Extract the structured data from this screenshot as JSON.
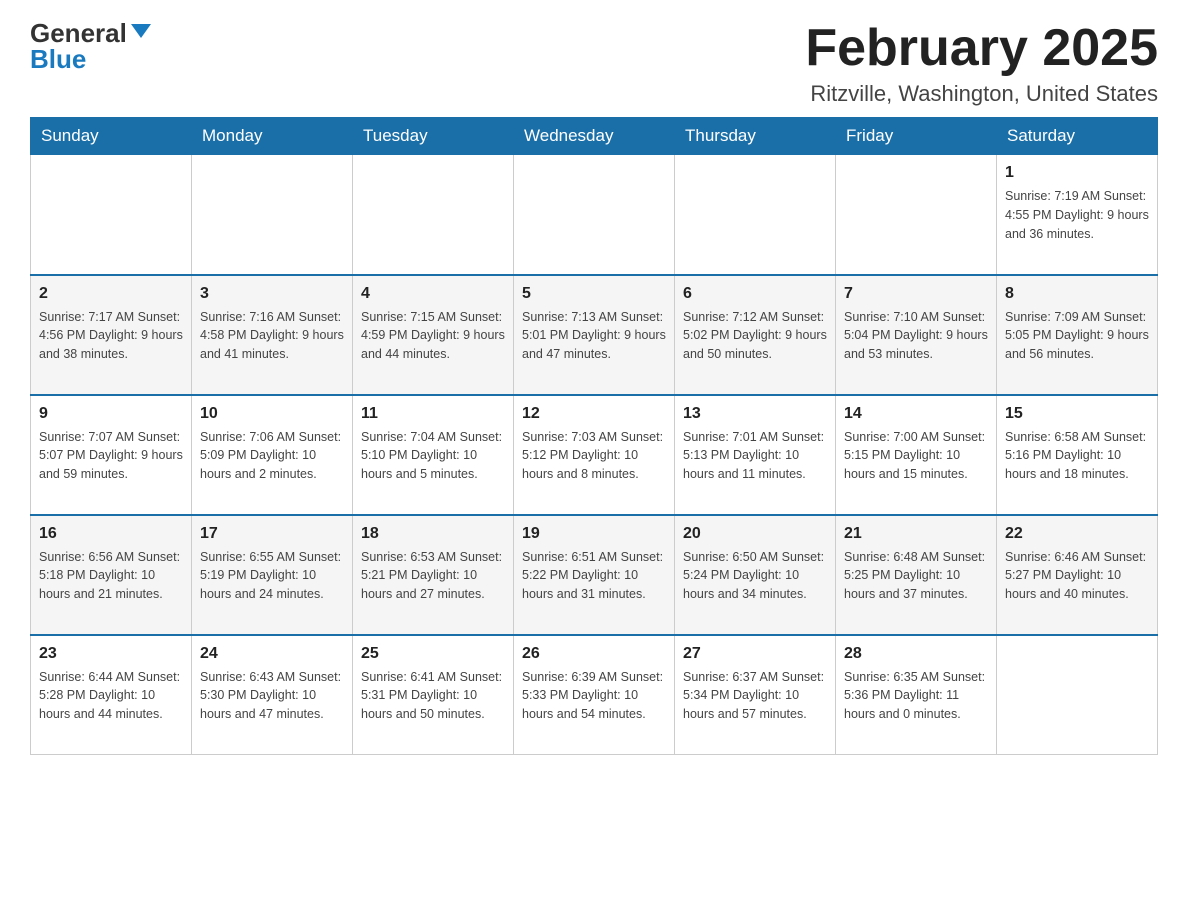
{
  "header": {
    "logo_general": "General",
    "logo_blue": "Blue",
    "title": "February 2025",
    "subtitle": "Ritzville, Washington, United States"
  },
  "days_of_week": [
    "Sunday",
    "Monday",
    "Tuesday",
    "Wednesday",
    "Thursday",
    "Friday",
    "Saturday"
  ],
  "weeks": [
    {
      "days": [
        {
          "num": "",
          "info": ""
        },
        {
          "num": "",
          "info": ""
        },
        {
          "num": "",
          "info": ""
        },
        {
          "num": "",
          "info": ""
        },
        {
          "num": "",
          "info": ""
        },
        {
          "num": "",
          "info": ""
        },
        {
          "num": "1",
          "info": "Sunrise: 7:19 AM\nSunset: 4:55 PM\nDaylight: 9 hours and 36 minutes."
        }
      ]
    },
    {
      "days": [
        {
          "num": "2",
          "info": "Sunrise: 7:17 AM\nSunset: 4:56 PM\nDaylight: 9 hours and 38 minutes."
        },
        {
          "num": "3",
          "info": "Sunrise: 7:16 AM\nSunset: 4:58 PM\nDaylight: 9 hours and 41 minutes."
        },
        {
          "num": "4",
          "info": "Sunrise: 7:15 AM\nSunset: 4:59 PM\nDaylight: 9 hours and 44 minutes."
        },
        {
          "num": "5",
          "info": "Sunrise: 7:13 AM\nSunset: 5:01 PM\nDaylight: 9 hours and 47 minutes."
        },
        {
          "num": "6",
          "info": "Sunrise: 7:12 AM\nSunset: 5:02 PM\nDaylight: 9 hours and 50 minutes."
        },
        {
          "num": "7",
          "info": "Sunrise: 7:10 AM\nSunset: 5:04 PM\nDaylight: 9 hours and 53 minutes."
        },
        {
          "num": "8",
          "info": "Sunrise: 7:09 AM\nSunset: 5:05 PM\nDaylight: 9 hours and 56 minutes."
        }
      ]
    },
    {
      "days": [
        {
          "num": "9",
          "info": "Sunrise: 7:07 AM\nSunset: 5:07 PM\nDaylight: 9 hours and 59 minutes."
        },
        {
          "num": "10",
          "info": "Sunrise: 7:06 AM\nSunset: 5:09 PM\nDaylight: 10 hours and 2 minutes."
        },
        {
          "num": "11",
          "info": "Sunrise: 7:04 AM\nSunset: 5:10 PM\nDaylight: 10 hours and 5 minutes."
        },
        {
          "num": "12",
          "info": "Sunrise: 7:03 AM\nSunset: 5:12 PM\nDaylight: 10 hours and 8 minutes."
        },
        {
          "num": "13",
          "info": "Sunrise: 7:01 AM\nSunset: 5:13 PM\nDaylight: 10 hours and 11 minutes."
        },
        {
          "num": "14",
          "info": "Sunrise: 7:00 AM\nSunset: 5:15 PM\nDaylight: 10 hours and 15 minutes."
        },
        {
          "num": "15",
          "info": "Sunrise: 6:58 AM\nSunset: 5:16 PM\nDaylight: 10 hours and 18 minutes."
        }
      ]
    },
    {
      "days": [
        {
          "num": "16",
          "info": "Sunrise: 6:56 AM\nSunset: 5:18 PM\nDaylight: 10 hours and 21 minutes."
        },
        {
          "num": "17",
          "info": "Sunrise: 6:55 AM\nSunset: 5:19 PM\nDaylight: 10 hours and 24 minutes."
        },
        {
          "num": "18",
          "info": "Sunrise: 6:53 AM\nSunset: 5:21 PM\nDaylight: 10 hours and 27 minutes."
        },
        {
          "num": "19",
          "info": "Sunrise: 6:51 AM\nSunset: 5:22 PM\nDaylight: 10 hours and 31 minutes."
        },
        {
          "num": "20",
          "info": "Sunrise: 6:50 AM\nSunset: 5:24 PM\nDaylight: 10 hours and 34 minutes."
        },
        {
          "num": "21",
          "info": "Sunrise: 6:48 AM\nSunset: 5:25 PM\nDaylight: 10 hours and 37 minutes."
        },
        {
          "num": "22",
          "info": "Sunrise: 6:46 AM\nSunset: 5:27 PM\nDaylight: 10 hours and 40 minutes."
        }
      ]
    },
    {
      "days": [
        {
          "num": "23",
          "info": "Sunrise: 6:44 AM\nSunset: 5:28 PM\nDaylight: 10 hours and 44 minutes."
        },
        {
          "num": "24",
          "info": "Sunrise: 6:43 AM\nSunset: 5:30 PM\nDaylight: 10 hours and 47 minutes."
        },
        {
          "num": "25",
          "info": "Sunrise: 6:41 AM\nSunset: 5:31 PM\nDaylight: 10 hours and 50 minutes."
        },
        {
          "num": "26",
          "info": "Sunrise: 6:39 AM\nSunset: 5:33 PM\nDaylight: 10 hours and 54 minutes."
        },
        {
          "num": "27",
          "info": "Sunrise: 6:37 AM\nSunset: 5:34 PM\nDaylight: 10 hours and 57 minutes."
        },
        {
          "num": "28",
          "info": "Sunrise: 6:35 AM\nSunset: 5:36 PM\nDaylight: 11 hours and 0 minutes."
        },
        {
          "num": "",
          "info": ""
        }
      ]
    }
  ]
}
